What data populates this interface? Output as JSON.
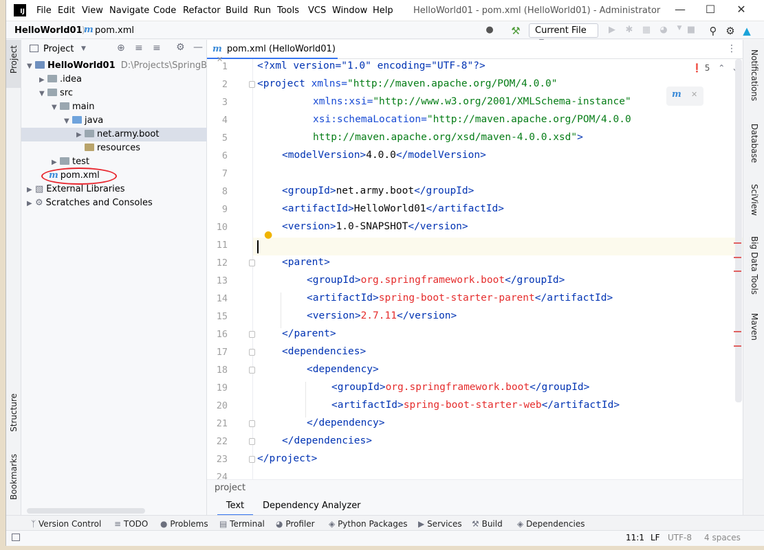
{
  "title_bar": {
    "logo": "IJ",
    "menus": [
      "File",
      "Edit",
      "View",
      "Navigate",
      "Code",
      "Refactor",
      "Build",
      "Run",
      "Tools",
      "VCS",
      "Window",
      "Help"
    ],
    "window_title": "HelloWorld01 - pom.xml (HelloWorld01) - Administrator"
  },
  "nav_bar": {
    "breadcrumb_project": "HelloWorld01",
    "breadcrumb_file": "pom.xml",
    "run_config": "Current File"
  },
  "left_stripe": {
    "project": "Project",
    "structure": "Structure",
    "bookmarks": "Bookmarks"
  },
  "project_panel": {
    "header": "Project",
    "tree": [
      {
        "label": "HelloWorld01",
        "path": "D:\\Projects\\SpringBoot\\"
      },
      {
        "label": ".idea"
      },
      {
        "label": "src"
      },
      {
        "label": "main"
      },
      {
        "label": "java"
      },
      {
        "label": "net.army.boot"
      },
      {
        "label": "resources"
      },
      {
        "label": "test"
      },
      {
        "label": "pom.xml"
      },
      {
        "label": "External Libraries"
      },
      {
        "label": "Scratches and Consoles"
      }
    ]
  },
  "editor": {
    "tab_label": "pom.xml (HelloWorld01)",
    "problems_count": "5",
    "line_numbers": [
      "1",
      "2",
      "3",
      "4",
      "5",
      "6",
      "7",
      "8",
      "9",
      "10",
      "11",
      "12",
      "13",
      "14",
      "15",
      "16",
      "17",
      "18",
      "19",
      "20",
      "21",
      "22",
      "23",
      "24"
    ],
    "code": {
      "l1_decl": "<?xml version=\"1.0\" encoding=\"UTF-8\"?>",
      "l2_tag": "<project ",
      "l2_attr": "xmlns=",
      "l2_val": "\"http://maven.apache.org/POM/4.0.0\"",
      "l3_attr": "xmlns:xsi=",
      "l3_val": "\"http://www.w3.org/2001/XMLSchema-instance\"",
      "l4_attr": "xsi:schemaLocation=",
      "l4_val": "\"http://maven.apache.org/POM/4.0.0",
      "l5_val": "http://maven.apache.org/xsd/maven-4.0.0.xsd\"",
      "l5_close": ">",
      "l6": [
        "<modelVersion>",
        "4.0.0",
        "</modelVersion>"
      ],
      "l8": [
        "<groupId>",
        "net.army.boot",
        "</groupId>"
      ],
      "l9": [
        "<artifactId>",
        "HelloWorld01",
        "</artifactId>"
      ],
      "l10": [
        "<version>",
        "1.0-SNAPSHOT",
        "</version>"
      ],
      "l12": "<parent>",
      "l13": [
        "<groupId>",
        "org.springframework.boot",
        "</groupId>"
      ],
      "l14": [
        "<artifactId>",
        "spring-boot-starter-parent",
        "</artifactId>"
      ],
      "l15": [
        "<version>",
        "2.7.11",
        "</version>"
      ],
      "l16": "</parent>",
      "l17": "<dependencies>",
      "l18": "<dependency>",
      "l19": [
        "<groupId>",
        "org.springframework.boot",
        "</groupId>"
      ],
      "l20": [
        "<artifactId>",
        "spring-boot-starter-web",
        "</artifactId>"
      ],
      "l21": "</dependency>",
      "l22": "</dependencies>",
      "l23": "</project>"
    },
    "bottom_breadcrumb": "project",
    "bottom_tabs": [
      "Text",
      "Dependency Analyzer"
    ]
  },
  "right_stripe": [
    "Notifications",
    "Database",
    "SciView",
    "Big Data Tools",
    "Maven"
  ],
  "status_bar": {
    "tools": [
      "Version Control",
      "TODO",
      "Problems",
      "Terminal",
      "Profiler",
      "Python Packages",
      "Services",
      "Build",
      "Dependencies"
    ],
    "position": "11:1",
    "line_sep": "LF",
    "encoding": "UTF-8",
    "indent": "4 spaces"
  },
  "annotation": {
    "color": "#e8262e"
  }
}
